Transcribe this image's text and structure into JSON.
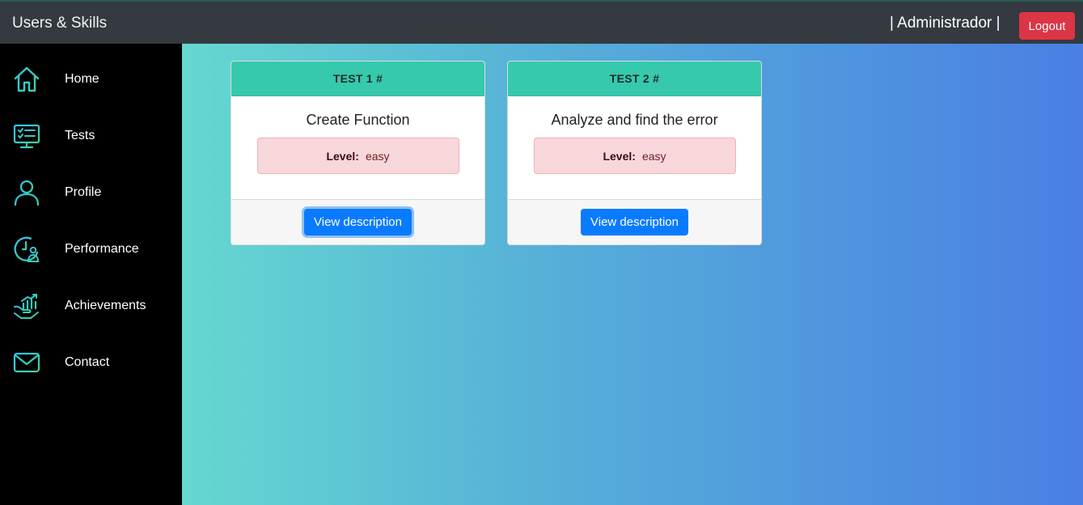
{
  "app": {
    "brand": "Users & Skills",
    "user": "| Administrador |",
    "logout_label": "Logout"
  },
  "sidebar": {
    "items": [
      {
        "label": "Home",
        "icon": "home-icon"
      },
      {
        "label": "Tests",
        "icon": "tests-monitor-icon"
      },
      {
        "label": "Profile",
        "icon": "profile-icon"
      },
      {
        "label": "Performance",
        "icon": "performance-icon"
      },
      {
        "label": "Achievements",
        "icon": "achievements-icon"
      },
      {
        "label": "Contact",
        "icon": "envelope-icon"
      }
    ],
    "icon_gradient": [
      "#2ec5e8",
      "#3fd0a0"
    ]
  },
  "tests": [
    {
      "header": "TEST 1 #",
      "title": "Create Function",
      "level_label": "Level:",
      "level": "easy",
      "button": "View description"
    },
    {
      "header": "TEST 2 #",
      "title": "Analyze and find the error",
      "level_label": "Level:",
      "level": "easy",
      "button": "View description"
    }
  ],
  "colors": {
    "card_header": "#36c9ad",
    "level_bg": "#f8d7da",
    "button": "#0a7bff",
    "logout": "#dc3545"
  }
}
